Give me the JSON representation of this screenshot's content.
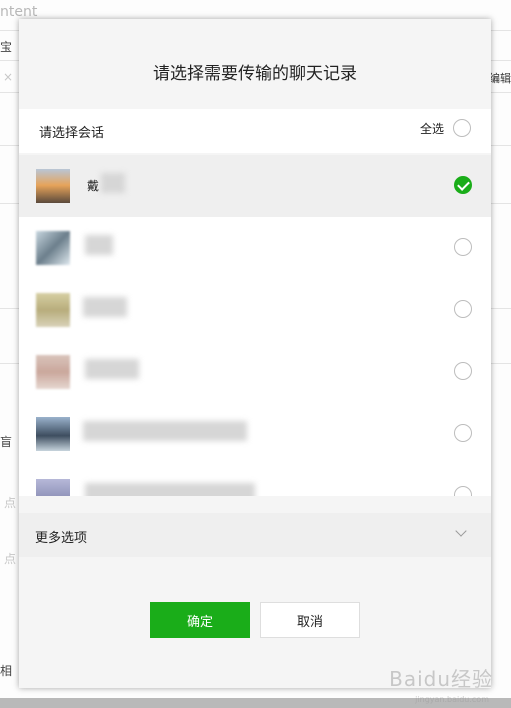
{
  "background": {
    "title_fragment": "ntent",
    "left_fragments": [
      "宝",
      "×",
      "盲",
      "点",
      "点",
      "相"
    ],
    "right_fragment": "编辑"
  },
  "dialog": {
    "title": "请选择需要传输的聊天记录",
    "section_label": "请选择会话",
    "select_all_label": "全选",
    "sessions": [
      {
        "name": "戴",
        "selected": true
      },
      {
        "name": "",
        "selected": false
      },
      {
        "name": "",
        "selected": false
      },
      {
        "name": "",
        "selected": false
      },
      {
        "name": "",
        "selected": false
      },
      {
        "name": "",
        "selected": false
      }
    ],
    "more_options_label": "更多选项",
    "confirm_label": "确定",
    "cancel_label": "取消"
  },
  "watermark": {
    "text": "Baidu经验",
    "sub": "jingyan.baidu.com"
  },
  "colors": {
    "accent_green": "#1aad19",
    "dialog_bg": "#f5f5f5"
  }
}
